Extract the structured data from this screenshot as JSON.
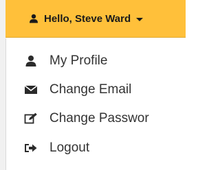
{
  "header": {
    "greeting": "Hello, Steve Ward",
    "icon": "user-icon",
    "accent_color": "#ffc03a"
  },
  "menu": {
    "items": [
      {
        "label": "My Profile",
        "icon": "user-icon"
      },
      {
        "label": "Change Email",
        "icon": "envelope-icon"
      },
      {
        "label": "Change Passwor",
        "icon": "edit-icon"
      },
      {
        "label": "Logout",
        "icon": "sign-out-icon"
      }
    ]
  }
}
